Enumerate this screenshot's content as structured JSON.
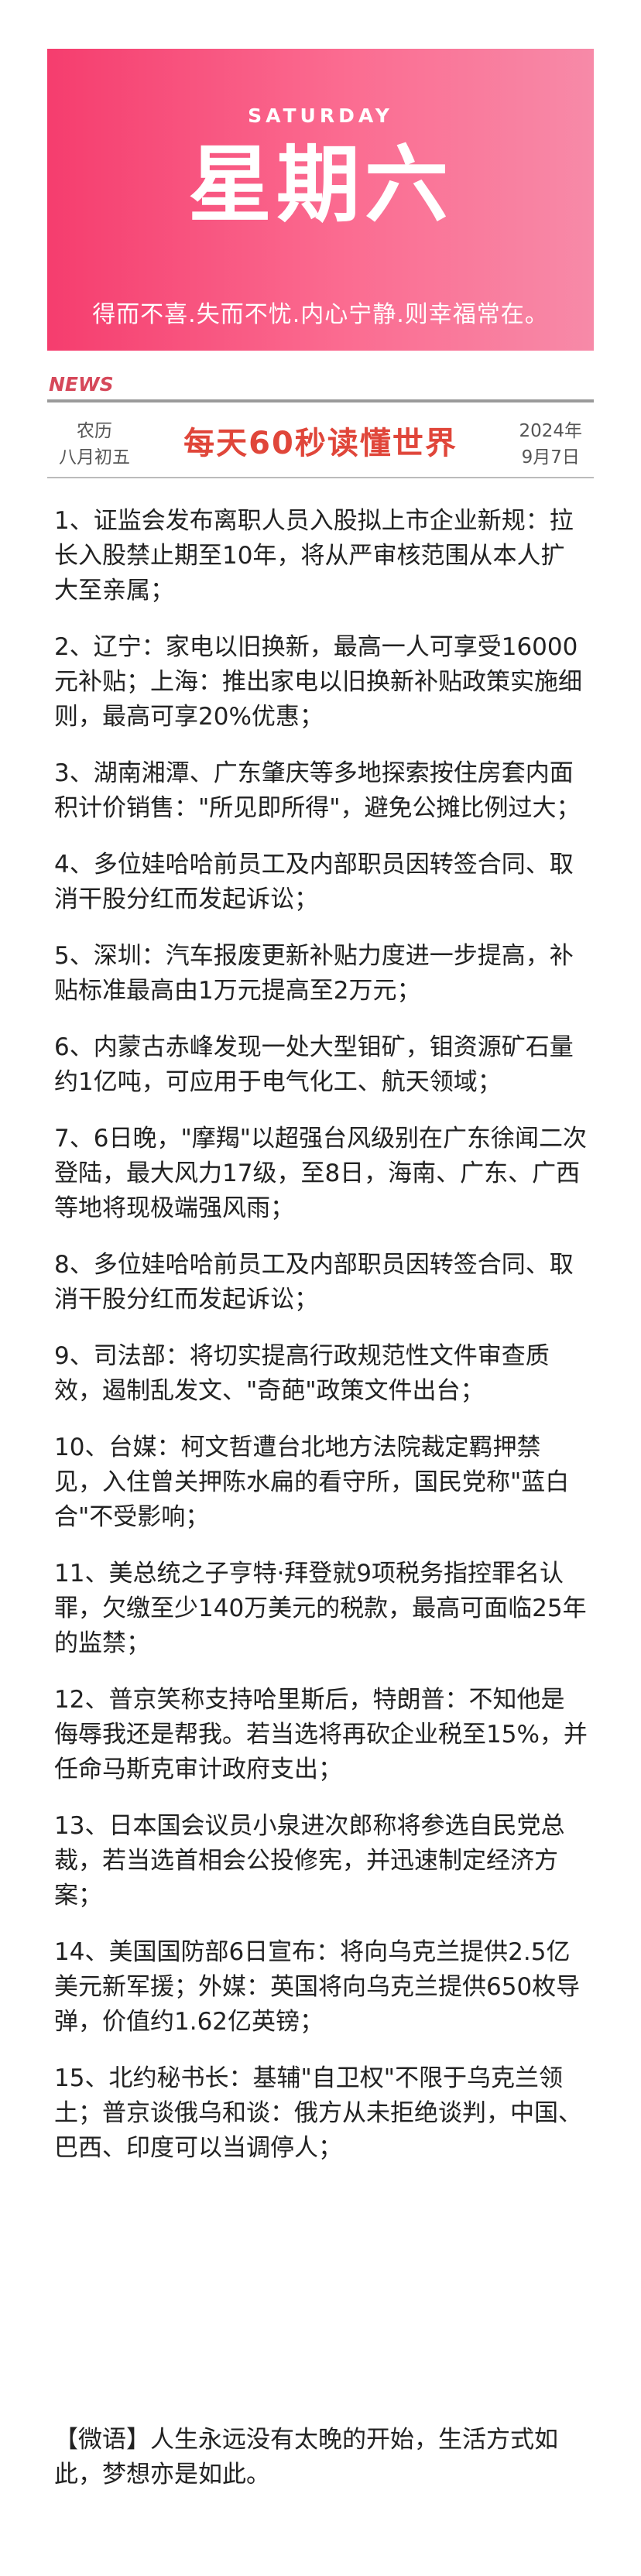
{
  "banner": {
    "weekday_en": "SATURDAY",
    "weekday_cn": "星期六",
    "motto": "得而不喜.失而不忧.内心宁静.则幸福常在。"
  },
  "header": {
    "tag": "NEWS",
    "lunar_label": "农历",
    "lunar_date": "八月初五",
    "headline": "每天60秒读懂世界",
    "year": "2024年",
    "month_day": "9月7日"
  },
  "items": [
    "1、证监会发布离职人员入股拟上市企业新规：拉长入股禁止期至10年，将从严审核范围从本人扩大至亲属；",
    "2、辽宁：家电以旧换新，最高一人可享受16000元补贴；上海：推出家电以旧换新补贴政策实施细则，最高可享20%优惠；",
    "3、湖南湘潭、广东肇庆等多地探索按住房套内面积计价销售：\"所见即所得\"，避免公摊比例过大；",
    "4、多位娃哈哈前员工及内部职员因转签合同、取消干股分红而发起诉讼；",
    "5、深圳：汽车报废更新补贴力度进一步提高，补贴标准最高由1万元提高至2万元；",
    "6、内蒙古赤峰发现一处大型钼矿，钼资源矿石量约1亿吨，可应用于电气化工、航天领域；",
    "7、6日晚，\"摩羯\"以超强台风级别在广东徐闻二次登陆，最大风力17级，至8日，海南、广东、广西等地将现极端强风雨；",
    "8、多位娃哈哈前员工及内部职员因转签合同、取消干股分红而发起诉讼；",
    "9、司法部：将切实提高行政规范性文件审查质效，遏制乱发文、\"奇葩\"政策文件出台；",
    "10、台媒：柯文哲遭台北地方法院裁定羁押禁见，入住曾关押陈水扁的看守所，国民党称\"蓝白合\"不受影响；",
    "11、美总统之子亨特·拜登就9项税务指控罪名认罪，欠缴至少140万美元的税款，最高可面临25年的监禁；",
    "12、普京笑称支持哈里斯后，特朗普：不知他是侮辱我还是帮我。若当选将再砍企业税至15%，并任命马斯克审计政府支出；",
    "13、日本国会议员小泉进次郎称将参选自民党总裁，若当选首相会公投修宪，并迅速制定经济方案；",
    "14、美国国防部6日宣布：将向乌克兰提供2.5亿美元新军援；外媒：英国将向乌克兰提供650枚导弹，价值约1.62亿英镑；",
    "15、北约秘书长：基辅\"自卫权\"不限于乌克兰领土；普京谈俄乌和谈：俄方从未拒绝谈判，中国、巴西、印度可以当调停人；"
  ],
  "footer": {
    "quote": "【微语】人生永远没有太晚的开始，生活方式如此，梦想亦是如此。"
  }
}
